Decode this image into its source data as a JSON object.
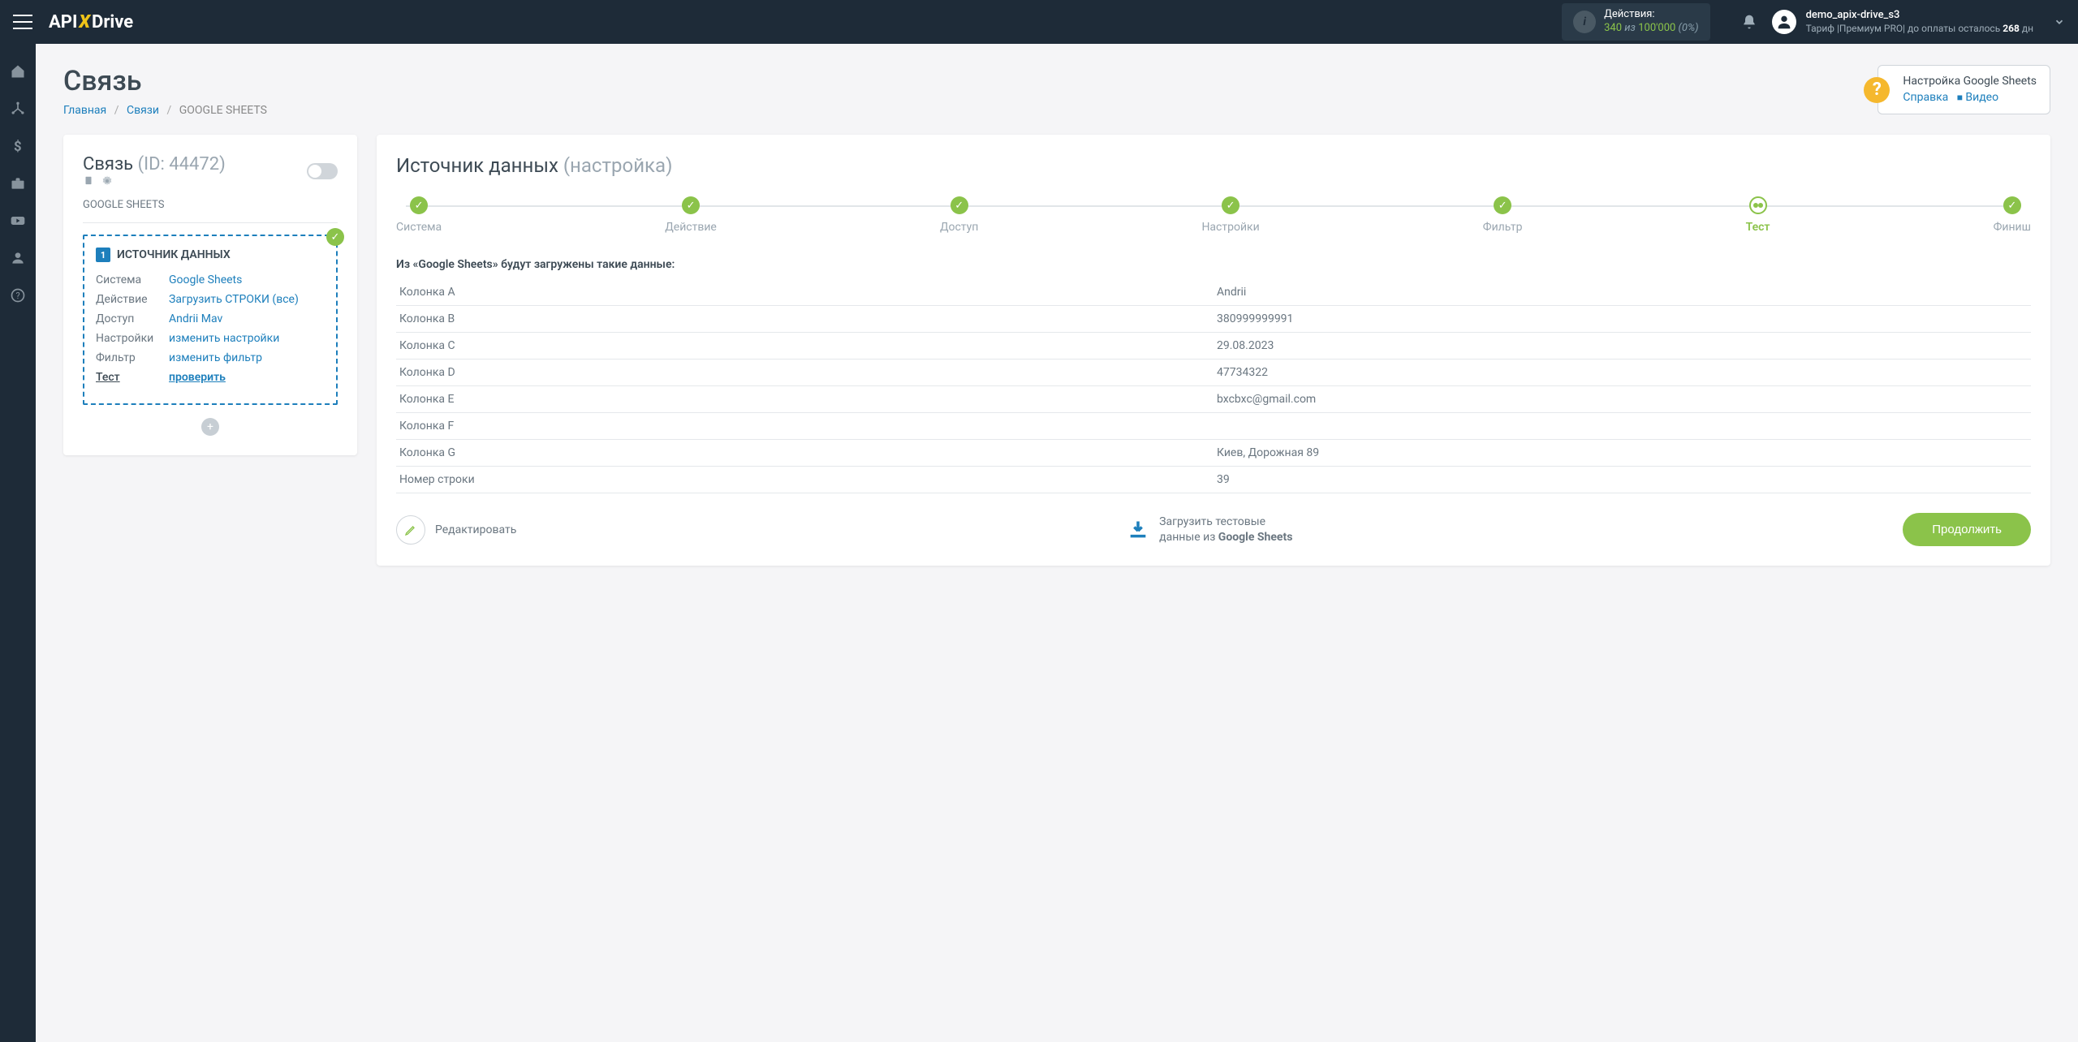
{
  "topbar": {
    "logo_pre": "API",
    "logo_x": "X",
    "logo_post": "Drive",
    "actions_label": "Действия:",
    "actions_used": "340",
    "actions_of": "из",
    "actions_total": "100'000",
    "actions_pct": "(0%)",
    "user_name": "demo_apix-drive_s3",
    "user_plan_prefix": "Тариф |Премиум PRO| до оплаты осталось ",
    "user_plan_days": "268",
    "user_plan_suffix": " дн"
  },
  "page": {
    "title": "Связь",
    "breadcrumb": {
      "home": "Главная",
      "links": "Связи",
      "current": "GOOGLE SHEETS"
    }
  },
  "help": {
    "title": "Настройка Google Sheets",
    "ref": "Справка",
    "video": "Видео"
  },
  "leftcard": {
    "title": "Связь",
    "id_label": "(ID: 44472)",
    "subtitle": "GOOGLE SHEETS",
    "source_head": "ИСТОЧНИК ДАННЫХ",
    "rows": [
      {
        "k": "Система",
        "v": "Google Sheets"
      },
      {
        "k": "Действие",
        "v": "Загрузить СТРОКИ (все)"
      },
      {
        "k": "Доступ",
        "v": "Andrii Mav"
      },
      {
        "k": "Настройки",
        "v": "изменить настройки"
      },
      {
        "k": "Фильтр",
        "v": "изменить фильтр"
      },
      {
        "k": "Тест",
        "v": "проверить"
      }
    ]
  },
  "rightcard": {
    "title": "Источник данных",
    "subtitle": "(настройка)",
    "steps": [
      "Система",
      "Действие",
      "Доступ",
      "Настройки",
      "Фильтр",
      "Тест",
      "Финиш"
    ],
    "current_step": 5,
    "data_title": "Из «Google Sheets» будут загружены такие данные:",
    "table": [
      {
        "k": "Колонка A",
        "v": "Andrii"
      },
      {
        "k": "Колонка B",
        "v": "380999999991"
      },
      {
        "k": "Колонка C",
        "v": "29.08.2023"
      },
      {
        "k": "Колонка D",
        "v": "47734322"
      },
      {
        "k": "Колонка E",
        "v": "bxcbxc@gmail.com"
      },
      {
        "k": "Колонка F",
        "v": ""
      },
      {
        "k": "Колонка G",
        "v": "Киев, Дорожная 89"
      },
      {
        "k": "Номер строки",
        "v": "39"
      }
    ],
    "edit": "Редактировать",
    "load_l1": "Загрузить тестовые",
    "load_l2a": "данные из ",
    "load_l2b": "Google Sheets",
    "continue": "Продолжить"
  }
}
